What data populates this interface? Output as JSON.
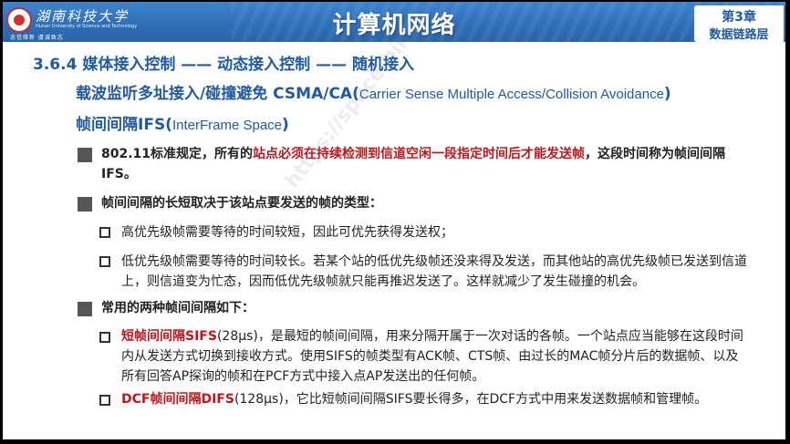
{
  "header": {
    "university_name": "湖南科技大学",
    "university_en": "Hunan University of Science and Technology",
    "motto": "忠信维新  虞诚致志",
    "course_title": "计算机网络",
    "chapter_number": "第3章",
    "chapter_name": "数据链路层"
  },
  "content": {
    "section_heading": "3.6.4 媒体接入控制 —— 动态接入控制 —— 随机接入",
    "subheading_1_cn": "载波监听多址接入/碰撞避免 CSMA/CA(",
    "subheading_1_en": "Carrier Sense Multiple Access/Collision Avoidance",
    "subheading_1_close": ")",
    "subheading_2_cn": "帧间间隔IFS(",
    "subheading_2_en": "InterFrame Space",
    "subheading_2_close": ")",
    "bullet_1_pre": "802.11标准规定，所有的",
    "bullet_1_red": "站点必须在持续检测到信道空闲一段指定时间后才能发送帧",
    "bullet_1_post": "，这段时间称为帧间间隔IFS。",
    "bullet_2": "帧间间隔的长短取决于该站点要发送的帧的类型：",
    "sub_2_1": "高优先级帧需要等待的时间较短，因此可优先获得发送权；",
    "sub_2_2": "低优先级帧需要等待的时间较长。若某个站的低优先级帧还没来得及发送，而其他站的高优先级帧已发送到信道上，则信道变为忙态，因而低优先级帧就只能再推迟发送了。这样就减少了发生碰撞的机会。",
    "bullet_3": "常用的两种帧间间隔如下：",
    "sub_3_1_red": "短帧间间隔SIFS",
    "sub_3_1_text": "(28μs)，是最短的帧间间隔，用来分隔开属于一次对话的各帧。一个站点应当能够在这段时间内从发送方式切换到接收方式。使用SIFS的帧类型有ACK帧、CTS帧、由过长的MAC帧分片后的数据帧、以及所有回答AP探询的帧和在PCF方式中接入点AP发送出的任何帧。",
    "sub_3_2_red": "DCF帧间间隔DIFS",
    "sub_3_2_text": "(128μs)，它比短帧间间隔SIFS要长得多，在DCF方式中用来发送数据帧和管理帧。"
  },
  "watermark": "https://space.bilibili.com/360996402  湖科大教书匠  gaoyongxiang@hnust.edu.cn",
  "colors": {
    "header_blue": "#2f6fb8",
    "heading_blue": "#1f5aa3",
    "emphasis_red": "#c0161b"
  }
}
